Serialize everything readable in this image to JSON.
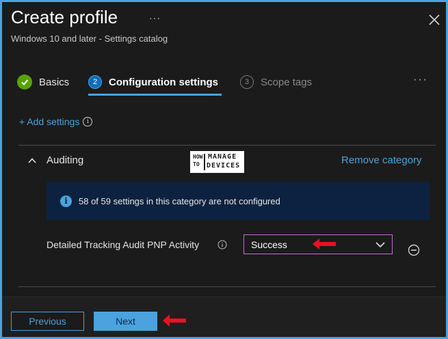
{
  "header": {
    "title": "Create profile",
    "more_label": "···",
    "subtitle": "Windows 10 and later - Settings catalog"
  },
  "steps": [
    {
      "number": "✓",
      "label": "Basics",
      "state": "completed"
    },
    {
      "number": "2",
      "label": "Configuration settings",
      "state": "active"
    },
    {
      "number": "3",
      "label": "Scope tags",
      "state": "upcoming"
    }
  ],
  "steps_more_label": "···",
  "add_settings": {
    "label": "+ Add settings",
    "info_glyph": "i"
  },
  "category": {
    "title": "Auditing",
    "remove_label": "Remove category",
    "banner_glyph": "i",
    "banner_text": "58 of 59 settings in this category are not configured"
  },
  "logo": {
    "how": "HOW",
    "to": "TO",
    "manage": "MANAGE",
    "devices": "DEVICES"
  },
  "setting": {
    "label": "Detailed Tracking Audit PNP Activity",
    "value": "Success"
  },
  "footer": {
    "previous_label": "Previous",
    "next_label": "Next"
  },
  "colors": {
    "accent": "#4aa3df",
    "success_green": "#57a300",
    "annotation_red": "#e81123",
    "banner_bg": "#0d2240",
    "select_border": "#c66bd3"
  },
  "icons": [
    "close-icon",
    "checkmark-icon",
    "chevron-up-icon",
    "info-icon",
    "chevron-down-icon",
    "remove-circle-icon",
    "red-arrow-icon"
  ]
}
